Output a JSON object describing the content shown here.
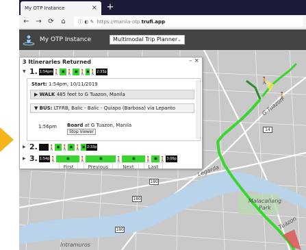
{
  "browser": {
    "tab_title": "My OTP Instance",
    "tab_close": "×",
    "new_tab": "+",
    "nav": {
      "back": "←",
      "forward": "→",
      "reload": "⟳",
      "home": "⌂"
    },
    "url_icons": "ⓘ ◐ ✎",
    "url_prefix": "https://manila-otp.",
    "url_domain": "trufi.app"
  },
  "app": {
    "title": "My OTP Instance",
    "mode_selected": "Multimodal Trip Planner",
    "mode_caret": "⌄"
  },
  "panel": {
    "title": "3 Itineraries Returned",
    "controls": "–  ×",
    "itineraries": [
      {
        "num": "1.",
        "caret": "▼",
        "start_time": "1:54pm",
        "end_time": "2:33p"
      },
      {
        "num": "2.",
        "caret": "▶",
        "start_time": "",
        "end_time": "2:33p"
      },
      {
        "num": "3.",
        "caret": "▶",
        "start_time": "1:54p",
        "end_time": "3:06p"
      }
    ],
    "details": {
      "start_label": "Start:",
      "start_value": "1:54pm, 10/11/2019",
      "walk_caret": "▶",
      "walk_mode": "WALK",
      "walk_text": "485 feet to G Tuazon, Manila",
      "bus_caret": "▼",
      "bus_mode": "BUS:",
      "bus_text": "LTFRB, Balic - Balic - Quiapo (Barbosa) via Lepanto",
      "stop_time": "1:56pm",
      "stop_board_label": "Board",
      "stop_board_text": "at G Tuazon, Manila",
      "stop_viewer": "Stop Viewer"
    },
    "pager": {
      "first": "First",
      "previous": "Previous",
      "next": "Next",
      "last": "Last"
    }
  },
  "map": {
    "labels": {
      "malacanang": "Malacañang",
      "park": "Park",
      "etuazon": "Tuazon",
      "intramuros": "Intramuros",
      "gtuazon": "G Tuazon",
      "legarda": "Legarda"
    },
    "shields": [
      "180",
      "180",
      "180",
      "14"
    ],
    "colors": {
      "bus_route": "#39d631",
      "walk_route": "#2e8b2e",
      "river": "#b9d4ea",
      "arrow": "#f5b41a"
    }
  }
}
